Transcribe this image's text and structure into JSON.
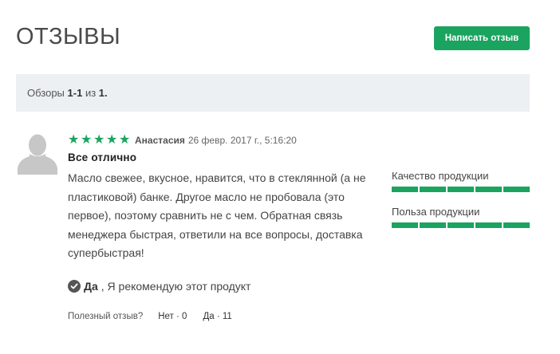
{
  "header": {
    "title": "ОТЗЫВЫ",
    "write_button": "Написать отзыв"
  },
  "summary": {
    "prefix": "Обзоры",
    "range": "1-1",
    "of": "из",
    "total": "1."
  },
  "review": {
    "rating": 5,
    "rating_max": 5,
    "author": "Анастасия",
    "date": "26 февр. 2017 г., 5:16:20",
    "title": "Все отлично",
    "body": "Масло свежее, вкусное, нравится, что в стеклянной (а не пластиковой) банке. Другое масло не пробовала (это первое), поэтому сравнить не с чем. Обратная связь менеджера быстрая, ответили на все вопросы, доставка супербыстрая!",
    "recommend_yes": "Да",
    "recommend_text": ", Я рекомендую этот продукт",
    "helpful_question": "Полезный отзыв?",
    "vote_no": "Нет · 0",
    "vote_yes": "Да · 11"
  },
  "ratings": [
    {
      "label": "Качество продукции",
      "value": 5,
      "max": 5
    },
    {
      "label": "Польза продукции",
      "value": 5,
      "max": 5
    }
  ],
  "colors": {
    "accent": "#1aa45f",
    "summary_bg": "#ecf0f3"
  }
}
